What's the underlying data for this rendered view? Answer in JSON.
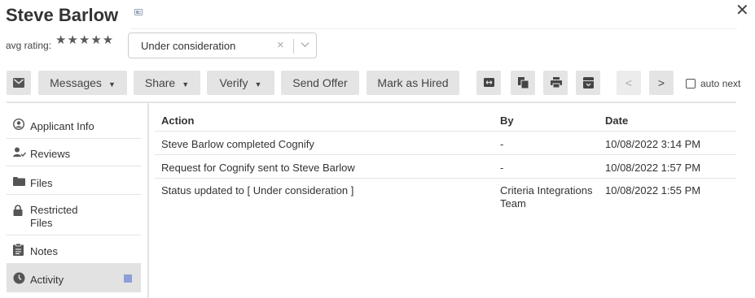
{
  "header": {
    "name": "Steve Barlow",
    "close_glyph": "✕"
  },
  "rating": {
    "label": "avg rating:",
    "stars": "★★★★★"
  },
  "status_select": {
    "value": "Under consideration",
    "clear_glyph": "×",
    "chevron_glyph": "﹀"
  },
  "toolbar": {
    "messages": "Messages",
    "share": "Share",
    "verify": "Verify",
    "send_offer": "Send Offer",
    "mark_hired": "Mark as Hired",
    "caret": "▼",
    "prev": "<",
    "next": ">",
    "auto_next": "auto next"
  },
  "sidebar": {
    "items": [
      {
        "label": "Applicant Info",
        "icon": "user-circle-icon"
      },
      {
        "label": "Reviews",
        "icon": "user-check-icon"
      },
      {
        "label": "Files",
        "icon": "folder-icon"
      },
      {
        "label": "Restricted\nFiles",
        "icon": "lock-icon"
      },
      {
        "label": "Notes",
        "icon": "clipboard-icon"
      },
      {
        "label": "Activity",
        "icon": "clock-icon"
      }
    ]
  },
  "activity": {
    "columns": [
      "Action",
      "By",
      "Date"
    ],
    "rows": [
      {
        "action": "Steve Barlow completed Cognify",
        "by": "-",
        "date": "10/08/2022 3:14 PM"
      },
      {
        "action": "Request for Cognify sent to Steve Barlow",
        "by": "-",
        "date": "10/08/2022 1:57 PM"
      },
      {
        "action": "Status updated to [ Under consideration ]",
        "by": "Criteria Integrations Team",
        "date": "10/08/2022 1:55 PM"
      }
    ]
  },
  "colors": {
    "button_bg": "#e4e4e4",
    "active_marker": "#8d9fd8"
  }
}
